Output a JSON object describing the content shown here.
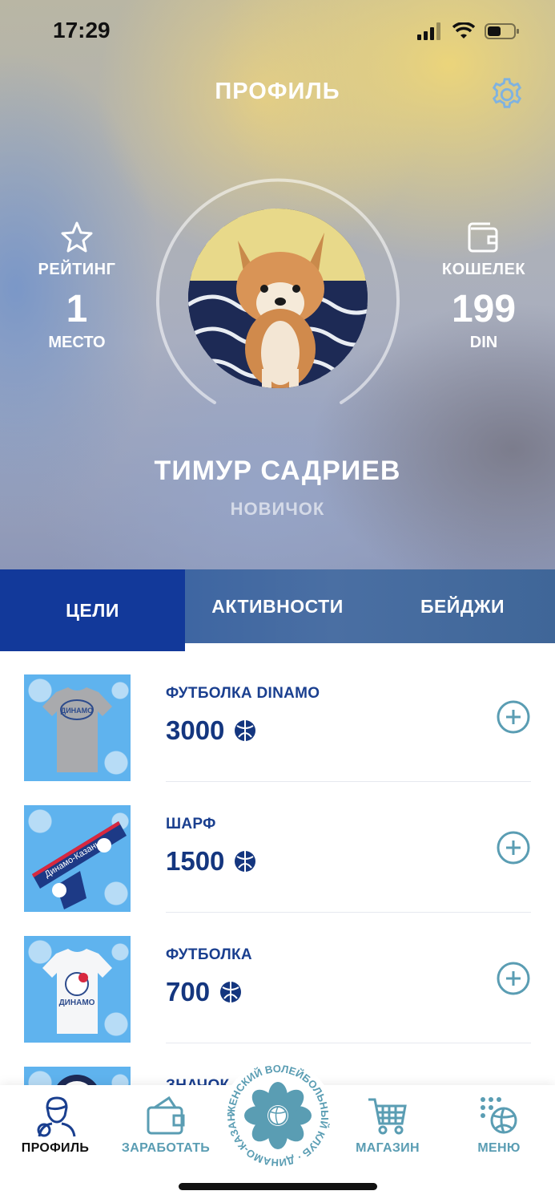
{
  "status_bar": {
    "time": "17:29"
  },
  "header": {
    "title": "ПРОФИЛЬ"
  },
  "profile": {
    "rating_label": "РЕЙТИНГ",
    "rating_value": "1",
    "rating_unit": "МЕСТО",
    "wallet_label": "КОШЕЛЕК",
    "wallet_value": "199",
    "wallet_unit": "DIN",
    "name": "ТИМУР САДРИЕВ",
    "level": "НОВИЧОК"
  },
  "tabs": [
    {
      "label": "ЦЕЛИ",
      "active": true
    },
    {
      "label": "АКТИВНОСТИ",
      "active": false
    },
    {
      "label": "БЕЙДЖИ",
      "active": false
    }
  ],
  "goals": [
    {
      "name": "ФУТБОЛКА DINAMO",
      "price": "3000"
    },
    {
      "name": "ШАРФ",
      "price": "1500"
    },
    {
      "name": "ФУТБОЛКА",
      "price": "700"
    },
    {
      "name": "ЗНАЧОК",
      "price": ""
    }
  ],
  "bottom_nav": {
    "profile": "ПРОФИЛЬ",
    "earn": "ЗАРАБОТАТЬ",
    "logo_text": "ЖЕНСКИЙ ВОЛЕЙБОЛЬНЫЙ КЛУБ · ДИНАМО-КАЗАНЬ ·",
    "shop": "МАГАЗИН",
    "menu": "МЕНЮ"
  },
  "colors": {
    "primary_blue": "#12399a",
    "text_blue": "#1a3f8f",
    "accent_teal": "#5a9db3",
    "thumb_bg": "#5fb3ee"
  }
}
